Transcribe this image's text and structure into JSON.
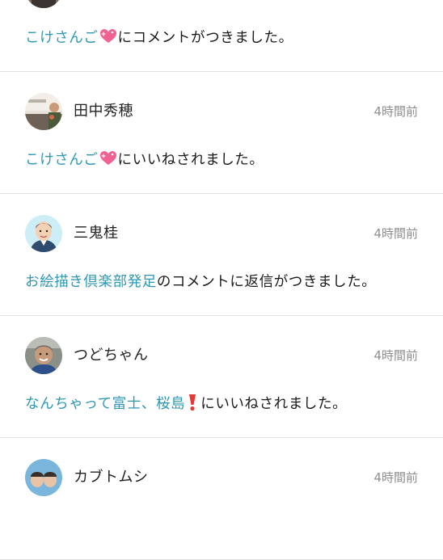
{
  "notifications": [
    {
      "user": "",
      "time": "",
      "link": "こけさんご",
      "emoji": "heart-sparkle",
      "rest": "にコメントがつきました。"
    },
    {
      "user": "田中秀穂",
      "time": "4時間前",
      "link": "こけさんご",
      "emoji": "heart-sparkle",
      "rest": "にいいねされました。"
    },
    {
      "user": "三鬼桂",
      "time": "4時間前",
      "link": "お絵描き倶楽部発足",
      "emoji": "",
      "rest": "のコメントに返信がつきました。"
    },
    {
      "user": "つどちゃん",
      "time": "4時間前",
      "link": "なんちゃって富士、桜島",
      "emoji": "red-exclamation",
      "rest": "にいいねされました。"
    },
    {
      "user": "カブトムシ",
      "time": "4時間前",
      "link": "",
      "emoji": "",
      "rest": ""
    }
  ],
  "colors": {
    "link": "#2e97b3",
    "time": "#8e8e8e",
    "divider": "#e2e2e2"
  }
}
